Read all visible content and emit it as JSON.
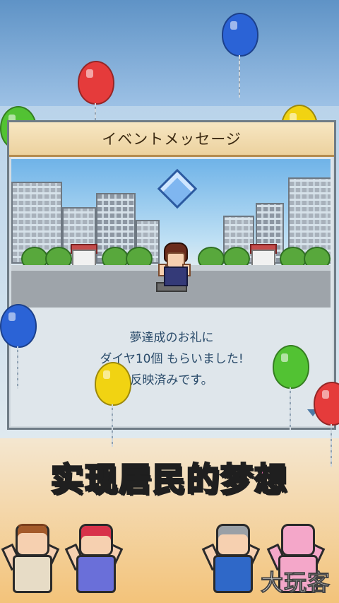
{
  "dialog": {
    "title": "イベントメッセージ",
    "message_line1": "夢達成のお礼に",
    "message_line2": "ダイヤ10個 もらいました!",
    "message_line3": "反映済みです。"
  },
  "banner": {
    "part1": "实现居民的",
    "part2": "梦想"
  },
  "watermark": "大玩客",
  "colors": {
    "balloon_red": "#e53b3b",
    "balloon_blue": "#2b63d6",
    "balloon_green": "#52c233",
    "balloon_yellow": "#f1d312",
    "banner_yellow": "#f8f4a8",
    "banner_pink": "#f26bb3"
  },
  "icons": {
    "reward": "diamond-icon",
    "next": "down-triangle-icon"
  }
}
